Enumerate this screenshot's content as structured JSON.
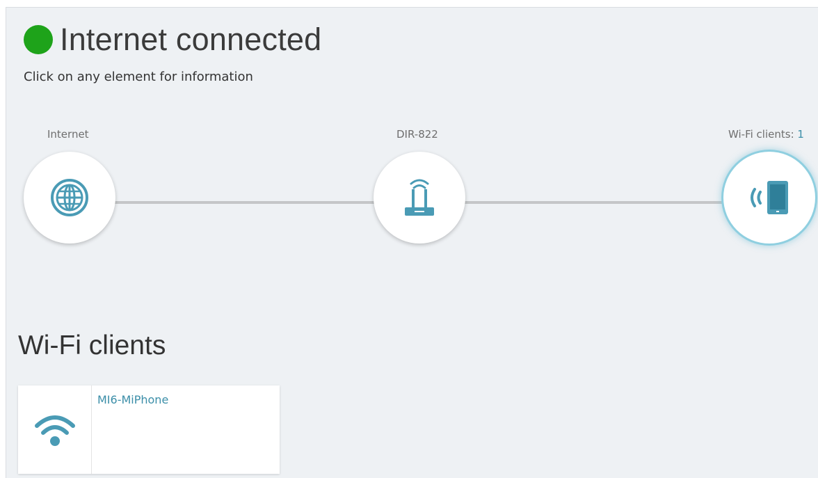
{
  "status": {
    "title": "Internet connected",
    "color": "#1ea31a",
    "hint": "Click on any element for information"
  },
  "topology": {
    "internet_label": "Internet",
    "device_label": "DIR-822",
    "clients_label": "Wi-Fi clients: ",
    "clients_count": "1",
    "icons": [
      "globe-icon",
      "router-icon",
      "wifi-tablet-icon"
    ]
  },
  "wifi_clients": {
    "title": "Wi-Fi clients",
    "items": [
      {
        "name": "MI6-MiPhone",
        "icon": "wifi-signal-icon"
      }
    ]
  },
  "colors": {
    "accent": "#3b8ea8",
    "icon": "#4a9bb5",
    "background": "#eef1f4"
  }
}
